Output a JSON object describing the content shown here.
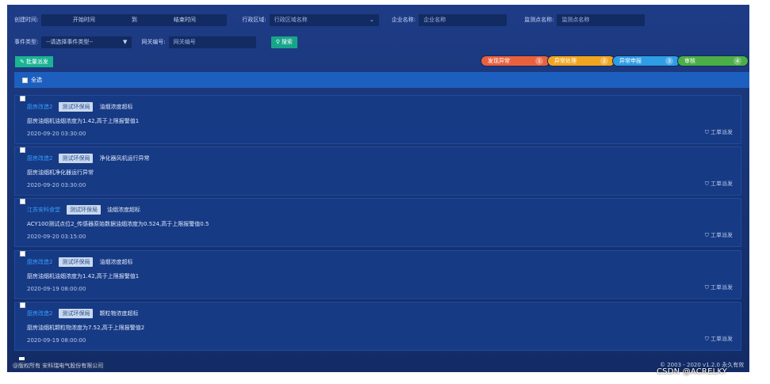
{
  "filters": {
    "create_time_label": "创建时间:",
    "start_time": "开始时间",
    "to": "到",
    "end_time": "结束时间",
    "region_label": "行政区域:",
    "region_placeholder": "行政区域名称",
    "company_label": "企业名称:",
    "company_placeholder": "企业名称",
    "monitor_label": "监测点名称:",
    "monitor_placeholder": "监测点名称",
    "event_type_label": "事件类型:",
    "event_type_value": "--请选择事件类型--",
    "gateway_label": "网关编号:",
    "gateway_placeholder": "网关编号",
    "search_label": "搜索"
  },
  "toolbar": {
    "batch_dispatch_label": "批量派发"
  },
  "steps": [
    {
      "label": "发现异常",
      "num": "1"
    },
    {
      "label": "异常处理",
      "num": "2"
    },
    {
      "label": "异常申报",
      "num": "3"
    },
    {
      "label": "审核",
      "num": "4"
    }
  ],
  "list": {
    "select_all_label": "全选",
    "dispatch_label": "工单派发",
    "items": [
      {
        "company": "厨房改造2",
        "tag": "测试环保局",
        "event_type": "油烟浓度超标",
        "desc": "厨房油烟机油烟浓度为1.42,高于上限报警值1",
        "time": "2020-09-20 03:30:00"
      },
      {
        "company": "厨房改造2",
        "tag": "测试环保局",
        "event_type": "净化器风机运行异常",
        "desc": "厨房油烟机净化器运行异常",
        "time": "2020-09-20 03:30:00"
      },
      {
        "company": "江苏安科食堂",
        "tag": "测试环保局",
        "event_type": "油烟浓度超标",
        "desc": "ACY100测试点位2_传感器原始数据油烟浓度为0.524,高于上限报警值0.5",
        "time": "2020-09-20 03:15:00"
      },
      {
        "company": "厨房改造2",
        "tag": "测试环保局",
        "event_type": "油烟浓度超标",
        "desc": "厨房油烟机油烟浓度为1.42,高于上限报警值1",
        "time": "2020-09-19 08:00:00"
      },
      {
        "company": "厨房改造2",
        "tag": "测试环保局",
        "event_type": "颗粒物浓度超标",
        "desc": "厨房油烟机颗粒物浓度为7.52,高于上限报警值2",
        "time": "2020-09-19 08:00:00"
      }
    ]
  },
  "footer": {
    "left": "@版权所有 安科瑞电气股份有限公司",
    "right": "© 2003 - 2020 v1.2.0 永久有效",
    "watermark": "CSDN @ACRELKY"
  },
  "colors": {
    "background": "#173372",
    "step1": "#e8613f",
    "step2": "#f0a521",
    "step3": "#2f9de4",
    "step4": "#4cae47",
    "accent_green": "#1ab394",
    "company_link": "#36a0ff"
  }
}
